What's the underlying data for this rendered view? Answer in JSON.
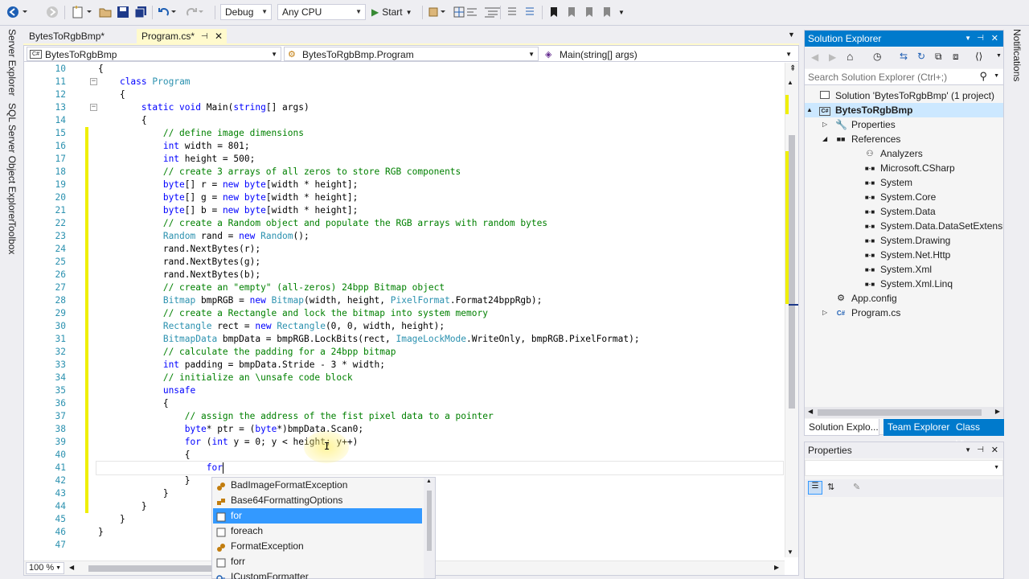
{
  "toolbar": {
    "config": "Debug",
    "platform": "Any CPU",
    "start_label": "Start"
  },
  "left_strip": {
    "tabs": [
      "Server Explorer",
      "SQL Server Object Explorer",
      "Toolbox"
    ]
  },
  "doc_tabs": [
    {
      "label": "BytesToRgbBmp*",
      "active": false
    },
    {
      "label": "Program.cs*",
      "active": true
    }
  ],
  "nav_bar": {
    "project": "BytesToRgbBmp",
    "type": "BytesToRgbBmp.Program",
    "member": "Main(string[] args)"
  },
  "code_lines": [
    {
      "n": "10",
      "segs": [
        [
          "t",
          "{"
        ]
      ]
    },
    {
      "n": "11",
      "segs": [
        [
          "t",
          "    "
        ],
        [
          "k",
          "class"
        ],
        [
          "t",
          " "
        ],
        [
          "y",
          "Program"
        ]
      ]
    },
    {
      "n": "12",
      "segs": [
        [
          "t",
          "    {"
        ]
      ]
    },
    {
      "n": "13",
      "segs": [
        [
          "t",
          "        "
        ],
        [
          "k",
          "static void"
        ],
        [
          "t",
          " Main("
        ],
        [
          "k",
          "string"
        ],
        [
          "t",
          "[] args)"
        ]
      ]
    },
    {
      "n": "14",
      "segs": [
        [
          "t",
          "        {"
        ]
      ]
    },
    {
      "n": "15",
      "segs": [
        [
          "t",
          "            "
        ],
        [
          "c",
          "// define image dimensions"
        ]
      ]
    },
    {
      "n": "16",
      "segs": [
        [
          "t",
          "            "
        ],
        [
          "k",
          "int"
        ],
        [
          "t",
          " width = 801;"
        ]
      ]
    },
    {
      "n": "17",
      "segs": [
        [
          "t",
          "            "
        ],
        [
          "k",
          "int"
        ],
        [
          "t",
          " height = 500;"
        ]
      ]
    },
    {
      "n": "18",
      "segs": [
        [
          "t",
          "            "
        ],
        [
          "c",
          "// create 3 arrays of all zeros to store RGB components"
        ]
      ]
    },
    {
      "n": "19",
      "segs": [
        [
          "t",
          "            "
        ],
        [
          "k",
          "byte"
        ],
        [
          "t",
          "[] r = "
        ],
        [
          "k",
          "new"
        ],
        [
          "t",
          " "
        ],
        [
          "k",
          "byte"
        ],
        [
          "t",
          "[width * height];"
        ]
      ]
    },
    {
      "n": "20",
      "segs": [
        [
          "t",
          "            "
        ],
        [
          "k",
          "byte"
        ],
        [
          "t",
          "[] g = "
        ],
        [
          "k",
          "new"
        ],
        [
          "t",
          " "
        ],
        [
          "k",
          "byte"
        ],
        [
          "t",
          "[width * height];"
        ]
      ]
    },
    {
      "n": "21",
      "segs": [
        [
          "t",
          "            "
        ],
        [
          "k",
          "byte"
        ],
        [
          "t",
          "[] b = "
        ],
        [
          "k",
          "new"
        ],
        [
          "t",
          " "
        ],
        [
          "k",
          "byte"
        ],
        [
          "t",
          "[width * height];"
        ]
      ]
    },
    {
      "n": "22",
      "segs": [
        [
          "t",
          "            "
        ],
        [
          "c",
          "// create a Random object and populate the RGB arrays with random bytes"
        ]
      ]
    },
    {
      "n": "23",
      "segs": [
        [
          "t",
          "            "
        ],
        [
          "y",
          "Random"
        ],
        [
          "t",
          " rand = "
        ],
        [
          "k",
          "new"
        ],
        [
          "t",
          " "
        ],
        [
          "y",
          "Random"
        ],
        [
          "t",
          "();"
        ]
      ]
    },
    {
      "n": "24",
      "segs": [
        [
          "t",
          "            rand.NextBytes(r);"
        ]
      ]
    },
    {
      "n": "25",
      "segs": [
        [
          "t",
          "            rand.NextBytes(g);"
        ]
      ]
    },
    {
      "n": "26",
      "segs": [
        [
          "t",
          "            rand.NextBytes(b);"
        ]
      ]
    },
    {
      "n": "27",
      "segs": [
        [
          "t",
          "            "
        ],
        [
          "c",
          "// create an \"empty\" (all-zeros) 24bpp Bitmap object"
        ]
      ]
    },
    {
      "n": "28",
      "segs": [
        [
          "t",
          "            "
        ],
        [
          "y",
          "Bitmap"
        ],
        [
          "t",
          " bmpRGB = "
        ],
        [
          "k",
          "new"
        ],
        [
          "t",
          " "
        ],
        [
          "y",
          "Bitmap"
        ],
        [
          "t",
          "(width, height, "
        ],
        [
          "y",
          "PixelFormat"
        ],
        [
          "t",
          ".Format24bppRgb);"
        ]
      ]
    },
    {
      "n": "29",
      "segs": [
        [
          "t",
          "            "
        ],
        [
          "c",
          "// create a Rectangle and lock the bitmap into system memory"
        ]
      ]
    },
    {
      "n": "30",
      "segs": [
        [
          "t",
          "            "
        ],
        [
          "y",
          "Rectangle"
        ],
        [
          "t",
          " rect = "
        ],
        [
          "k",
          "new"
        ],
        [
          "t",
          " "
        ],
        [
          "y",
          "Rectangle"
        ],
        [
          "t",
          "(0, 0, width, height);"
        ]
      ]
    },
    {
      "n": "31",
      "segs": [
        [
          "t",
          "            "
        ],
        [
          "y",
          "BitmapData"
        ],
        [
          "t",
          " bmpData = bmpRGB.LockBits(rect, "
        ],
        [
          "y",
          "ImageLockMode"
        ],
        [
          "t",
          ".WriteOnly, bmpRGB.PixelFormat);"
        ]
      ]
    },
    {
      "n": "32",
      "segs": [
        [
          "t",
          "            "
        ],
        [
          "c",
          "// calculate the padding for a 24bpp bitmap"
        ]
      ]
    },
    {
      "n": "33",
      "segs": [
        [
          "t",
          "            "
        ],
        [
          "k",
          "int"
        ],
        [
          "t",
          " padding = bmpData.Stride - 3 * width;"
        ]
      ]
    },
    {
      "n": "34",
      "segs": [
        [
          "t",
          "            "
        ],
        [
          "c",
          "// initialize an \\unsafe code block"
        ]
      ]
    },
    {
      "n": "35",
      "segs": [
        [
          "t",
          "            "
        ],
        [
          "k",
          "unsafe"
        ]
      ]
    },
    {
      "n": "36",
      "segs": [
        [
          "t",
          "            {"
        ]
      ]
    },
    {
      "n": "37",
      "segs": [
        [
          "t",
          "                "
        ],
        [
          "c",
          "// assign the address of the fist pixel data to a pointer"
        ]
      ]
    },
    {
      "n": "38",
      "segs": [
        [
          "t",
          "                "
        ],
        [
          "k",
          "byte"
        ],
        [
          "t",
          "* ptr = ("
        ],
        [
          "k",
          "byte"
        ],
        [
          "t",
          "*)bmpData.Scan0;"
        ]
      ]
    },
    {
      "n": "39",
      "segs": [
        [
          "t",
          "                "
        ],
        [
          "k",
          "for"
        ],
        [
          "t",
          " ("
        ],
        [
          "k",
          "int"
        ],
        [
          "t",
          " y = 0; y < height; y++)"
        ]
      ]
    },
    {
      "n": "40",
      "segs": [
        [
          "t",
          "                {"
        ]
      ]
    },
    {
      "n": "41",
      "segs": [
        [
          "t",
          "                    "
        ],
        [
          "k",
          "for"
        ]
      ]
    },
    {
      "n": "42",
      "segs": [
        [
          "t",
          "                }"
        ]
      ]
    },
    {
      "n": "43",
      "segs": [
        [
          "t",
          "            }"
        ]
      ]
    },
    {
      "n": "44",
      "segs": [
        [
          "t",
          "        }"
        ]
      ]
    },
    {
      "n": "45",
      "segs": [
        [
          "t",
          "    }"
        ]
      ]
    },
    {
      "n": "46",
      "segs": [
        [
          "t",
          "}"
        ]
      ]
    },
    {
      "n": "47",
      "segs": []
    }
  ],
  "intellisense": [
    {
      "label": "BadImageFormatException",
      "kind": "class",
      "selected": false
    },
    {
      "label": "Base64FormattingOptions",
      "kind": "enum",
      "selected": false
    },
    {
      "label": "for",
      "kind": "snippet",
      "selected": true
    },
    {
      "label": "foreach",
      "kind": "snippet",
      "selected": false
    },
    {
      "label": "FormatException",
      "kind": "class",
      "selected": false
    },
    {
      "label": "forr",
      "kind": "snippet",
      "selected": false
    },
    {
      "label": "ICustomFormatter",
      "kind": "interface",
      "selected": false
    }
  ],
  "zoom": "100 %",
  "solution_explorer": {
    "title": "Solution Explorer",
    "search_placeholder": "Search Solution Explorer (Ctrl+;)",
    "items": [
      {
        "label": "Solution 'BytesToRgbBmp' (1 project)",
        "level": 0,
        "icon": "solution-icon",
        "bold": false,
        "expander": ""
      },
      {
        "label": "BytesToRgbBmp",
        "level": 0,
        "icon": "csharp-project-icon",
        "bold": true,
        "expander": "▲"
      },
      {
        "label": "Properties",
        "level": 1,
        "icon": "wrench-icon",
        "bold": false,
        "expander": "▷"
      },
      {
        "label": "References",
        "level": 1,
        "icon": "references-icon",
        "bold": false,
        "expander": "◢"
      },
      {
        "label": "Analyzers",
        "level": 2,
        "icon": "analyzers-icon",
        "bold": false,
        "expander": ""
      },
      {
        "label": "Microsoft.CSharp",
        "level": 2,
        "icon": "reference-icon",
        "bold": false,
        "expander": ""
      },
      {
        "label": "System",
        "level": 2,
        "icon": "reference-icon",
        "bold": false,
        "expander": ""
      },
      {
        "label": "System.Core",
        "level": 2,
        "icon": "reference-icon",
        "bold": false,
        "expander": ""
      },
      {
        "label": "System.Data",
        "level": 2,
        "icon": "reference-icon",
        "bold": false,
        "expander": ""
      },
      {
        "label": "System.Data.DataSetExtensions",
        "level": 2,
        "icon": "reference-icon",
        "bold": false,
        "expander": ""
      },
      {
        "label": "System.Drawing",
        "level": 2,
        "icon": "reference-icon",
        "bold": false,
        "expander": ""
      },
      {
        "label": "System.Net.Http",
        "level": 2,
        "icon": "reference-icon",
        "bold": false,
        "expander": ""
      },
      {
        "label": "System.Xml",
        "level": 2,
        "icon": "reference-icon",
        "bold": false,
        "expander": ""
      },
      {
        "label": "System.Xml.Linq",
        "level": 2,
        "icon": "reference-icon",
        "bold": false,
        "expander": ""
      },
      {
        "label": "App.config",
        "level": 1,
        "icon": "config-file-icon",
        "bold": false,
        "expander": ""
      },
      {
        "label": "Program.cs",
        "level": 1,
        "icon": "csharp-file-icon",
        "bold": false,
        "expander": "▷"
      }
    ],
    "bottom_tabs": [
      "Solution Explo...",
      "Team Explorer",
      "Class View"
    ]
  },
  "properties": {
    "title": "Properties"
  },
  "right_strip": {
    "label": "Notifications"
  },
  "colors": {
    "accent": "#007acc",
    "selection": "#3399ff",
    "changed": "#efef00"
  }
}
